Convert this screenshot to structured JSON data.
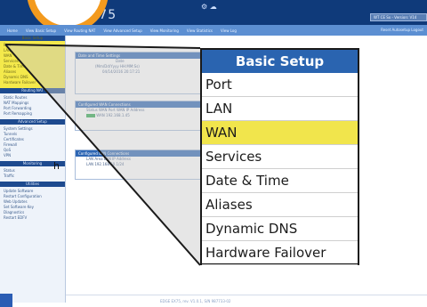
{
  "header": {
    "logo_text": "E 75",
    "status": "WT CE Sx - Version: V14"
  },
  "nav": {
    "items": [
      "Home",
      "View Basic Setup",
      "View Routing NAT",
      "View Advanced Setup",
      "View Monitoring",
      "View Statistics",
      "View Log"
    ],
    "right": "Reset Autosetup  Logout"
  },
  "sidebar": {
    "basic_header": "Basic Setup",
    "basic_items": [
      "Port",
      "LAN",
      "WAN",
      "Services",
      "Date & Time",
      "Aliases",
      "Dynamic DNS",
      "Hardware Failover"
    ],
    "routing_header": "Routing NAT",
    "routing_items": [
      "Static Routes",
      "NAT Mappings",
      "Port Forwarding",
      "Port Remapping"
    ],
    "advanced_header": "Advanced Setup",
    "advanced_items": [
      "System Settings",
      "Tunnels",
      "Certificates",
      "Firewall",
      "QoS",
      "VPN"
    ],
    "monitor_header": "Monitoring",
    "monitor_items": [
      "Status",
      "Traffic"
    ],
    "utilities_header": "Utilities",
    "utilities_items": [
      "Update Software",
      "Restart Configuration",
      "Web Updates",
      "Set Software Key",
      "Diagnostics",
      "Restart EDFV"
    ]
  },
  "panels": {
    "datetime_title": "Date and Time Settings",
    "datetime_row1": "Date",
    "datetime_row2": "(Mm/Dd/Yyyy HH:MM:Ss)",
    "datetime_row3": "04/14/2016 20:17:21",
    "wan_title": "Configured WAN Connections",
    "wan_row1": "Status   WAN Port   WAN IP Address",
    "wan_row2": "WAN    192.168.1.45",
    "lan_title": "Configured LAN Connections",
    "lan_row1": "LAN Area   LAN IP Address",
    "lan_row2": "LAN     192.168.50.1/24"
  },
  "zoom": {
    "title": "Basic Setup",
    "items": [
      "Port",
      "LAN",
      "WAN",
      "Services",
      "Date & Time",
      "Aliases",
      "Dynamic DNS",
      "Hardware Failover"
    ],
    "active_index": 2
  },
  "footer": {
    "text": "EDGE EX75, rev. V1.0.1, S/N 987733-02"
  },
  "left_letter": "h",
  "colors": {
    "header": "#0f3a7a",
    "nav": "#5c8fd2",
    "highlight": "#f1e54c",
    "accent": "#f39a1e",
    "title_blue": "#2a64b0"
  }
}
